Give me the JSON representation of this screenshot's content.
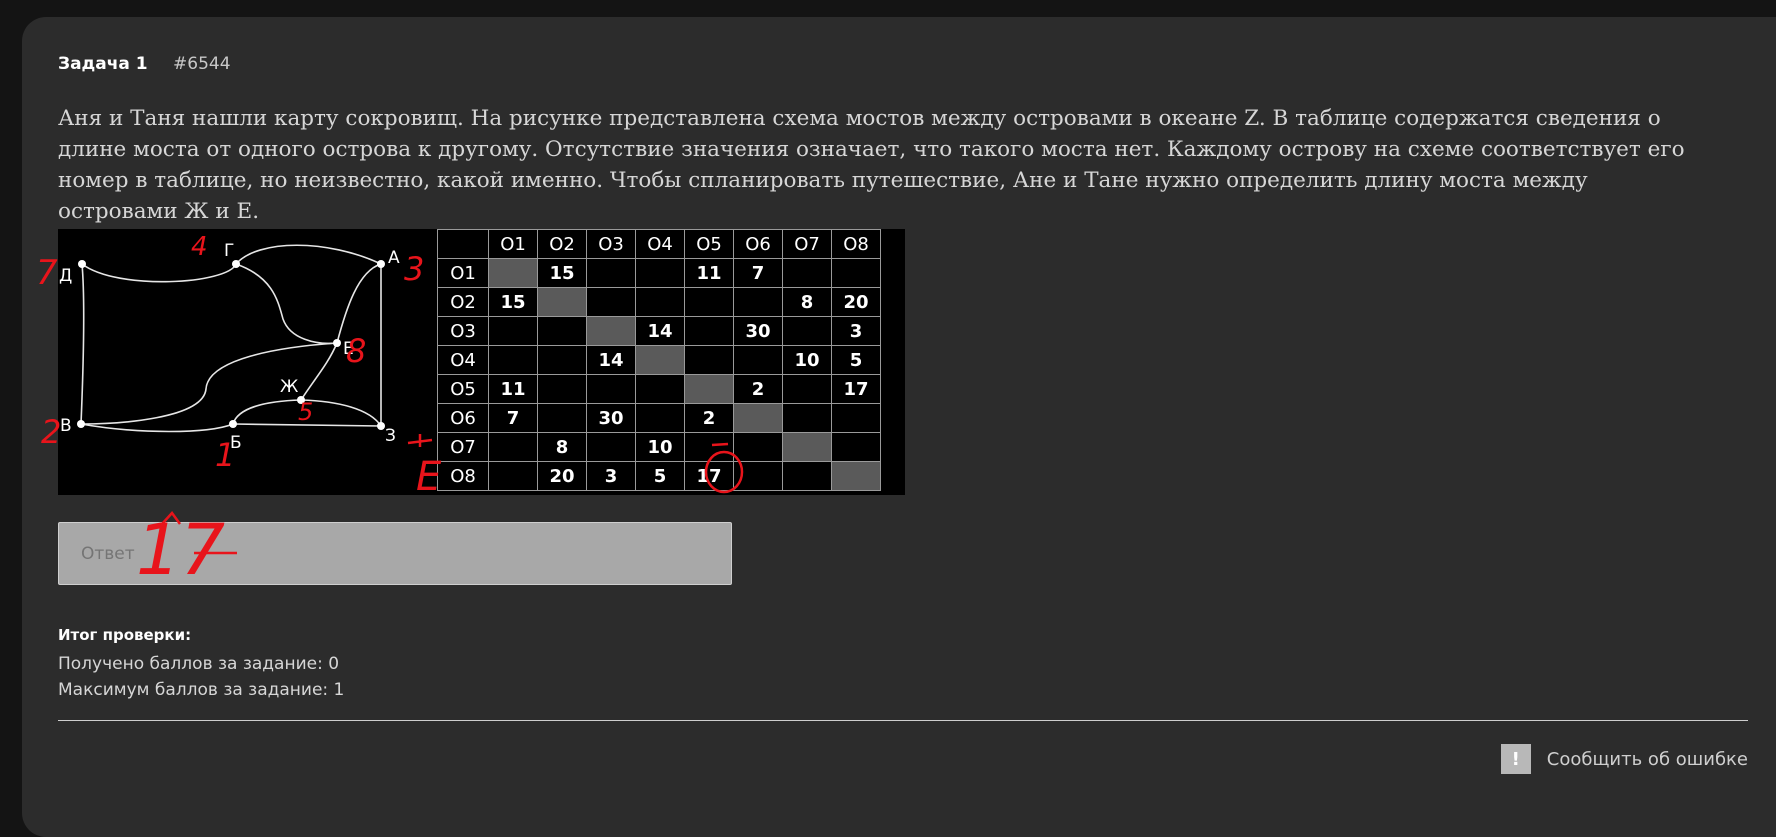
{
  "task": {
    "title": "Задача 1",
    "number": "#6544"
  },
  "statement": "Аня и Таня нашли карту сокровищ. На рисунке представлена схема мостов между островами в океане Z. В таблице содержатся сведения о длине моста от одного острова к другому. Отсутствие значения означает, что такого моста нет. Каждому острову на схеме соответствует его номер в таблице, но неизвестно, какой именно. Чтобы спланировать путешествие, Ане и Тане нужно определить длину моста между островами Ж и Е.",
  "map": {
    "nodes": {
      "D": "Д",
      "G": "Г",
      "A": "А",
      "E": "Е",
      "Zh": "Ж",
      "V": "В",
      "B": "Б",
      "Z": "З"
    }
  },
  "table": {
    "headers": [
      "О1",
      "О2",
      "О3",
      "О4",
      "О5",
      "О6",
      "О7",
      "О8"
    ],
    "rows": [
      {
        "label": "О1",
        "cells": [
          "",
          "15",
          "",
          "",
          "11",
          "7",
          "",
          ""
        ]
      },
      {
        "label": "О2",
        "cells": [
          "15",
          "",
          "",
          "",
          "",
          "",
          "8",
          "20"
        ]
      },
      {
        "label": "О3",
        "cells": [
          "",
          "",
          "",
          "14",
          "",
          "30",
          "",
          "3"
        ]
      },
      {
        "label": "О4",
        "cells": [
          "",
          "",
          "14",
          "",
          "",
          "",
          "10",
          "5"
        ]
      },
      {
        "label": "О5",
        "cells": [
          "11",
          "",
          "",
          "",
          "",
          "2",
          "",
          "17"
        ]
      },
      {
        "label": "О6",
        "cells": [
          "7",
          "",
          "30",
          "",
          "2",
          "",
          "",
          ""
        ]
      },
      {
        "label": "О7",
        "cells": [
          "",
          "8",
          "",
          "10",
          "",
          "",
          "",
          ""
        ]
      },
      {
        "label": "О8",
        "cells": [
          "",
          "20",
          "3",
          "5",
          "17",
          "",
          "",
          ""
        ]
      }
    ]
  },
  "handwriting": {
    "node_notes": [
      "7",
      "4",
      "3",
      "8",
      "5",
      "2",
      "1"
    ],
    "row_note": "Е",
    "answer_scrawl": "17"
  },
  "answer": {
    "placeholder": "Ответ"
  },
  "result": {
    "title": "Итог проверки:",
    "received": "Получено баллов за задание: 0",
    "max": "Максимум баллов за задание: 1"
  },
  "report": {
    "icon": "!",
    "label": "Сообщить об ошибке"
  },
  "colors": {
    "ink": "#e8141b",
    "diagonal": "#5a5a5a",
    "page": "#2c2c2c"
  }
}
